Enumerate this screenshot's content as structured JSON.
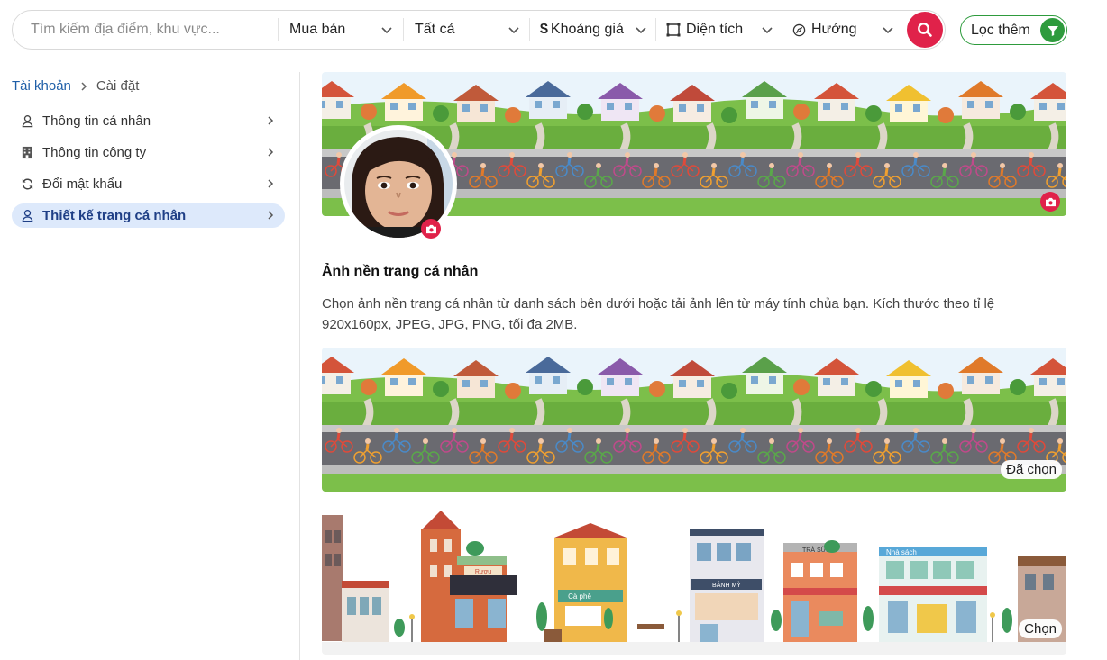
{
  "search": {
    "placeholder": "Tìm kiếm địa điểm, khu vực...",
    "filters": [
      {
        "label": "Mua bán"
      },
      {
        "label": "Tất cả"
      },
      {
        "label": "Khoảng giá",
        "icon": "dollar-icon"
      },
      {
        "label": "Diện tích",
        "icon": "area-square-icon"
      },
      {
        "label": "Hướng",
        "icon": "compass-icon"
      }
    ],
    "more_label": "Lọc thêm"
  },
  "breadcrumb": {
    "root": "Tài khoản",
    "current": "Cài đặt"
  },
  "sidebar": {
    "items": [
      {
        "label": "Thông tin cá nhân",
        "icon": "user-icon",
        "active": false
      },
      {
        "label": "Thông tin công ty",
        "icon": "building-icon",
        "active": false
      },
      {
        "label": "Đổi mật khẩu",
        "icon": "refresh-icon",
        "active": false
      },
      {
        "label": "Thiết kế trang cá nhân",
        "icon": "user-icon",
        "active": true
      }
    ]
  },
  "cover": {
    "section_title": "Ảnh nền trang cá nhân",
    "description": "Chọn ảnh nền trang cá nhân từ danh sách bên dưới hoặc tải ảnh lên từ máy tính chủa bạn. Kích thước theo tỉ lệ 920x160px, JPEG, JPG, PNG, tối đa 2MB.",
    "options": [
      {
        "badge": "Đã chọn",
        "selected": true
      },
      {
        "badge": "Chọn",
        "selected": false
      }
    ],
    "shop_signs": [
      "Rượu",
      "Cà phê",
      "BÁNH MỲ",
      "TRÀ SỮA",
      "Nhà sách"
    ]
  },
  "colors": {
    "accent": "#e0224a",
    "green": "#2e9b3d",
    "active_bg": "#dde9fb",
    "link": "#1f5fa8"
  }
}
